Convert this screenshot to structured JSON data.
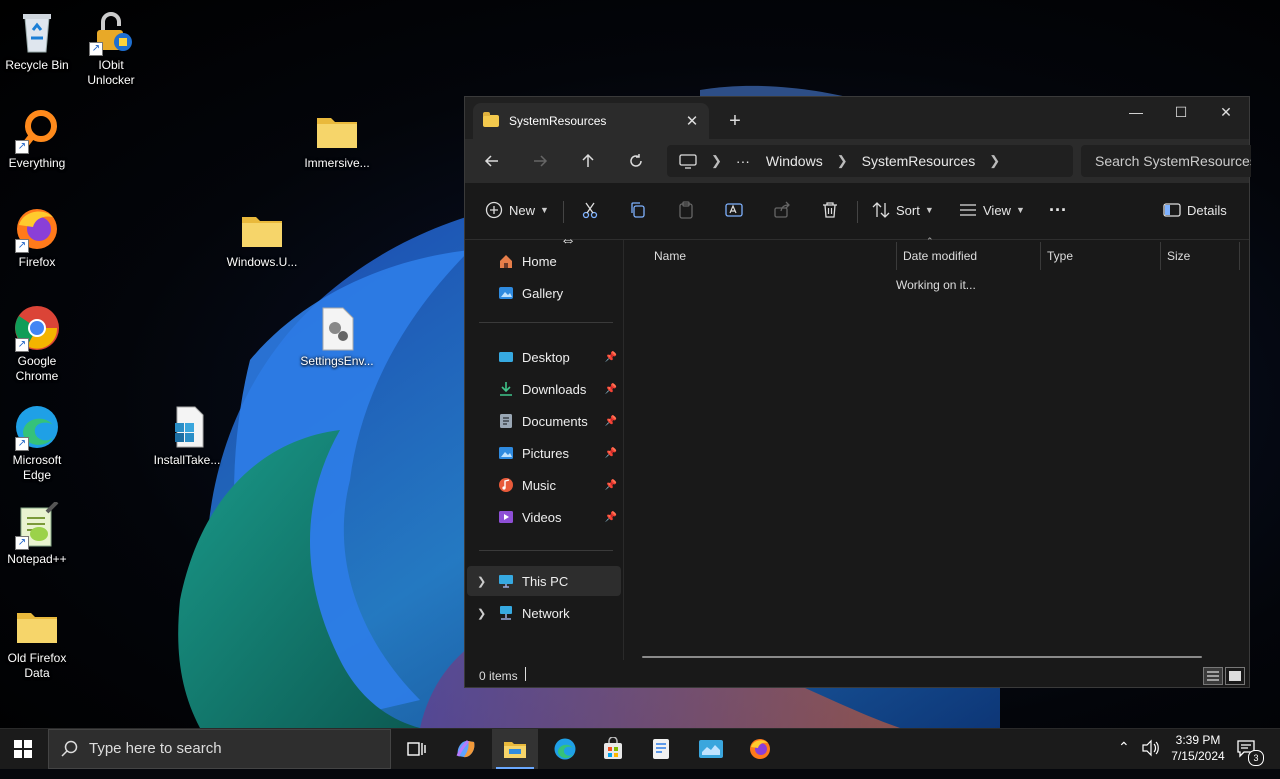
{
  "desktop": {
    "icons": [
      {
        "label": "Recycle Bin"
      },
      {
        "label": "IObit Unlocker"
      },
      {
        "label": "Everything"
      },
      {
        "label": "Firefox"
      },
      {
        "label": "Google Chrome"
      },
      {
        "label": "Microsoft Edge"
      },
      {
        "label": "Notepad++"
      },
      {
        "label": "Old Firefox Data"
      },
      {
        "label": "Immersive..."
      },
      {
        "label": "Windows.U..."
      },
      {
        "label": "SettingsEnv..."
      },
      {
        "label": "InstallTake..."
      }
    ]
  },
  "explorer": {
    "tab_title": "SystemResources",
    "tab_close": "✕",
    "new_tab": "+",
    "caption": {
      "minimize": "—",
      "maximize": "☐",
      "close": "✕"
    },
    "address": {
      "overflow": "···",
      "crumbs": [
        "Windows",
        "SystemResources"
      ]
    },
    "search_placeholder": "Search SystemResources",
    "toolbar": {
      "new_label": "New",
      "sort_label": "Sort",
      "view_label": "View",
      "more": "···",
      "details_label": "Details"
    },
    "sidebar": {
      "home": "Home",
      "gallery": "Gallery",
      "desktop": "Desktop",
      "downloads": "Downloads",
      "documents": "Documents",
      "pictures": "Pictures",
      "music": "Music",
      "videos": "Videos",
      "this_pc": "This PC",
      "network": "Network"
    },
    "columns": [
      "Name",
      "Date modified",
      "Type",
      "Size"
    ],
    "status_message": "Working on it...",
    "item_count": "0 items"
  },
  "taskbar": {
    "search_placeholder": "Type here to search",
    "time": "3:39 PM",
    "date": "7/15/2024",
    "notification_count": "3"
  },
  "colors": {
    "accent": "#6aa8ff",
    "folder": "#f3c94d",
    "window_bg": "#191919"
  }
}
